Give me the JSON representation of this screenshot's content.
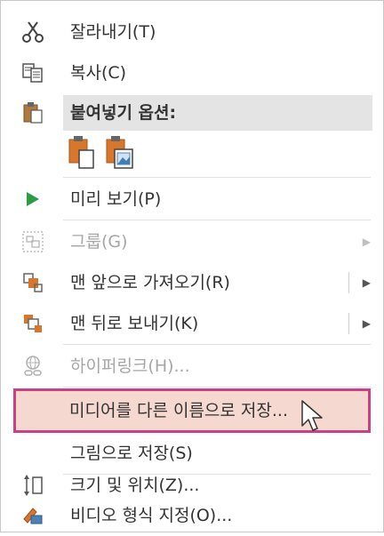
{
  "menu": {
    "cut": {
      "label": "잘라내기(T)",
      "icon": "scissors-icon"
    },
    "copy": {
      "label": "복사(C)",
      "icon": "copy-icon"
    },
    "paste_options": {
      "label": "붙여넣기 옵션:",
      "icon": "clipboard-icon"
    },
    "paste_buttons": [
      {
        "name": "paste-keep-formatting-icon"
      },
      {
        "name": "paste-as-picture-icon"
      }
    ],
    "preview": {
      "label": "미리 보기(P)",
      "icon": "play-icon"
    },
    "group": {
      "label": "그룹(G)",
      "icon": "group-icon",
      "disabled": true
    },
    "bring_forward": {
      "label": "맨 앞으로 가져오기(R)",
      "icon": "bring-to-front-icon"
    },
    "send_backward": {
      "label": "맨 뒤로 보내기(K)",
      "icon": "send-to-back-icon"
    },
    "hyperlink": {
      "label": "하이퍼링크(H)...",
      "icon": "hyperlink-icon",
      "disabled": true
    },
    "save_media_as": {
      "label": "미디어를 다른 이름으로 저장...",
      "highlighted": true
    },
    "save_as_picture": {
      "label": "그림으로 저장(S)"
    },
    "size_position": {
      "label": "크기 및 위치(Z)...",
      "icon": "size-position-icon"
    },
    "format_video": {
      "label": "비디오 형식 지정(O)...",
      "icon": "format-video-icon"
    }
  },
  "colors": {
    "highlight_border": "#cc3f86",
    "highlight_fill": "#f5d8cf",
    "play_green": "#2e9b45",
    "icon_orange": "#d8772b"
  }
}
